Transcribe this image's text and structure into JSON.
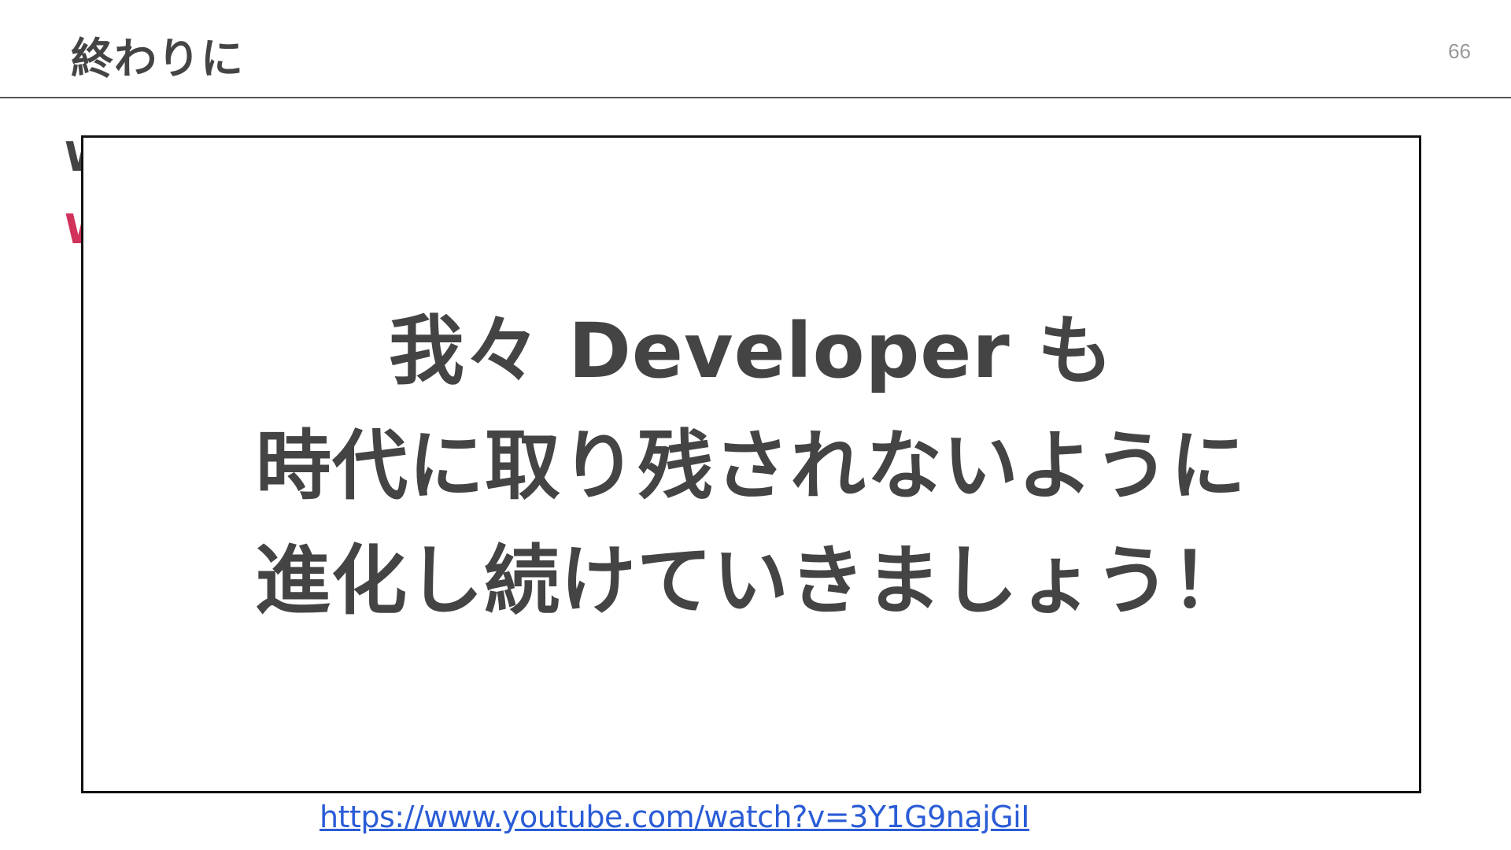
{
  "slide": {
    "title": "終わりに",
    "page_number": "66",
    "partial_lines": [
      "W",
      "W"
    ],
    "message": {
      "lines": [
        "我々 Developer も",
        "時代に取り残されないように",
        "進化し続けていきましょう！"
      ]
    },
    "link": {
      "text": "https://www.youtube.com/watch?v=3Y1G9najGiI"
    }
  },
  "colors": {
    "text": "#444444",
    "accent": "#d0325b",
    "link": "#2a5cd6",
    "page_number": "#999999",
    "box_border": "#111111"
  }
}
